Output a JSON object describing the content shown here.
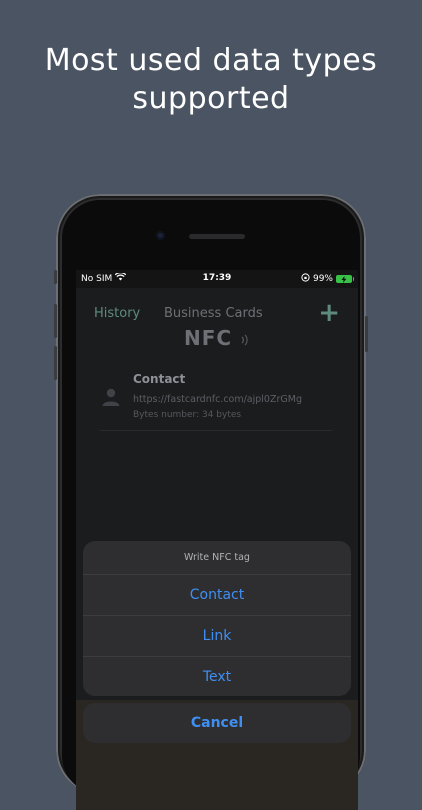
{
  "headline": {
    "line1": "Most used data types",
    "line2": "supported"
  },
  "status_bar": {
    "carrier": "No SIM",
    "time": "17:39",
    "battery_percent": "99%",
    "icons": [
      "wifi-icon",
      "orientation-lock-icon",
      "battery-charging-icon"
    ]
  },
  "app": {
    "nav": {
      "history_label": "History",
      "business_cards_label": "Business Cards",
      "add_icon": "plus-icon",
      "add_label": "+"
    },
    "title": "NFC",
    "records": [
      {
        "icon": "person-icon",
        "title": "Contact",
        "url": "https://fastcardnfc.com/ajpl0ZrGMg",
        "bytes": "Bytes number: 34 bytes"
      }
    ]
  },
  "action_sheet": {
    "title": "Write NFC tag",
    "options": [
      "Contact",
      "Link",
      "Text"
    ],
    "cancel_label": "Cancel",
    "accent_color": "#3f8ff2"
  }
}
